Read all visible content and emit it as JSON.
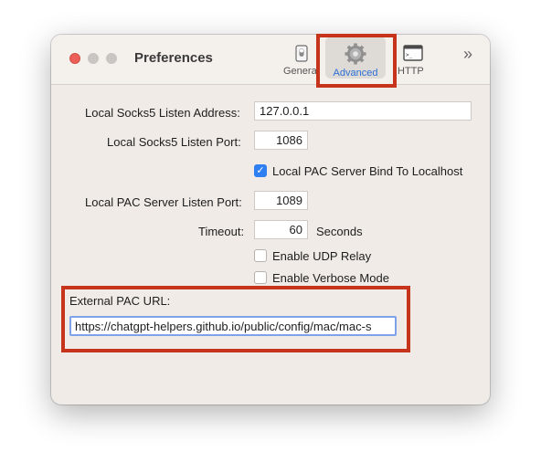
{
  "window": {
    "title": "Preferences"
  },
  "toolbar": {
    "tabs": [
      {
        "label": "General",
        "icon": "toggle-switch-icon"
      },
      {
        "label": "Advanced",
        "icon": "gear-icon",
        "selected": true
      },
      {
        "label": "HTTP",
        "icon": "terminal-icon"
      }
    ],
    "overflow_icon": "chevron-double-right-icon"
  },
  "form": {
    "socks5_address_label": "Local Socks5 Listen Address:",
    "socks5_address_value": "127.0.0.1",
    "socks5_port_label": "Local Socks5 Listen Port:",
    "socks5_port_value": "1086",
    "pac_bind_label": "Local PAC Server Bind To Localhost",
    "pac_bind_checked": true,
    "pac_port_label": "Local PAC Server Listen Port:",
    "pac_port_value": "1089",
    "timeout_label": "Timeout:",
    "timeout_value": "60",
    "timeout_unit": "Seconds",
    "udp_relay_label": "Enable UDP Relay",
    "udp_relay_checked": false,
    "verbose_label": "Enable Verbose Mode",
    "verbose_checked": false,
    "external_pac_label": "External PAC URL:",
    "external_pac_value": "https://chatgpt-helpers.github.io/public/config/mac/mac-s"
  },
  "colors": {
    "accent": "#2f7ef2",
    "highlight_box": "#c7341c",
    "selected_tab_text": "#2d6fd6"
  }
}
